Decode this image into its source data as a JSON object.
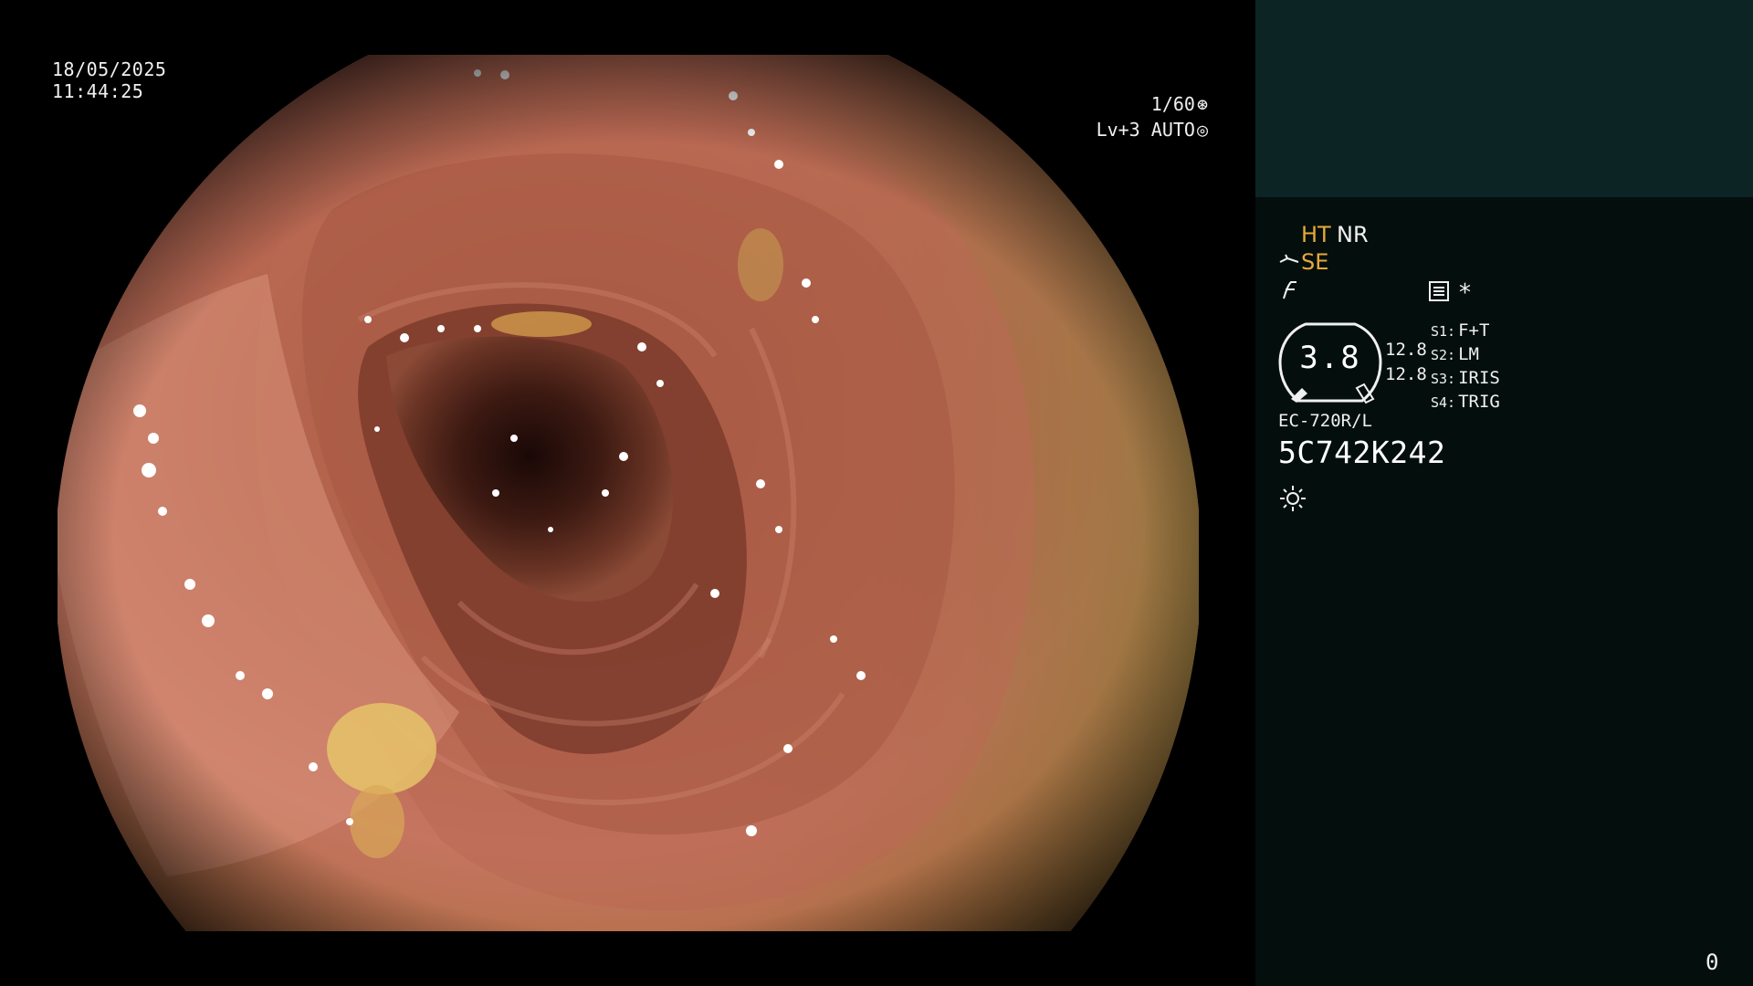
{
  "image": {
    "date": "18/05/2025",
    "time": "11:44:25",
    "shutter": "1/60",
    "shutter_icon": "aperture-icon",
    "level": "Lv+3",
    "exposure_mode": "AUTO",
    "exposure_icon": "iris-icon"
  },
  "panel": {
    "ht_label": "HT",
    "nr_label": "NR",
    "se_label": "SE",
    "se_icon": "structure-enhance-icon",
    "freeze_icon": "freeze-icon",
    "record_icon": "record-icon",
    "star_mark": "*",
    "gauge_value": "3.8",
    "val1": "12.8",
    "val2": "12.8",
    "switches": [
      {
        "key": "S1:",
        "value": "F+T"
      },
      {
        "key": "S2:",
        "value": "LM"
      },
      {
        "key": "S3:",
        "value": "IRIS"
      },
      {
        "key": "S4:",
        "value": "TRIG"
      }
    ],
    "scope_model": "EC-720R/L",
    "scope_serial": "5C742K242",
    "light_icon": "light-source-icon",
    "counter": "0"
  },
  "colors": {
    "panel_background": "#040f0d",
    "panel_top_background": "#0d2424",
    "accent_orange": "#e7a93a",
    "mucosa": "#b5624a"
  }
}
